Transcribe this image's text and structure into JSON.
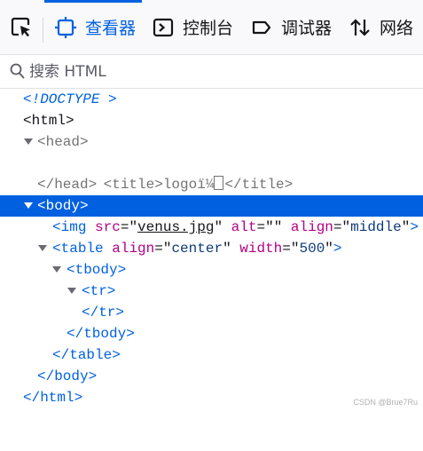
{
  "toolbar": {
    "tabs": [
      {
        "label": "查看器",
        "icon": "inspector-icon",
        "active": true
      },
      {
        "label": "控制台",
        "icon": "console-icon",
        "active": false
      },
      {
        "label": "调试器",
        "icon": "debugger-icon",
        "active": false
      },
      {
        "label": "网络",
        "icon": "network-icon",
        "active": false
      }
    ]
  },
  "search": {
    "placeholder": "搜索 HTML",
    "value": ""
  },
  "tree": {
    "doctype": "<!DOCTYPE >",
    "html_open": "<html>",
    "head_open": "<head>",
    "title_open": "<title>",
    "title_text": "logoï¼",
    "title_close": "</title>",
    "head_close": "</head>",
    "body_open": "<body>",
    "img_tag": "img",
    "img_src_attr": "src",
    "img_src_val": "venus.jpg",
    "img_alt_attr": "alt",
    "img_alt_val": "",
    "img_align_attr": "align",
    "img_align_val": "middle",
    "table_tag": "table",
    "table_align_attr": "align",
    "table_align_val": "center",
    "table_width_attr": "width",
    "table_width_val": "500",
    "tbody_open": "<tbody>",
    "tr_open": "<tr>",
    "tr_close": "</tr>",
    "tbody_close": "</tbody>",
    "table_close": "</table>",
    "body_close": "</body>",
    "html_close": "</html>"
  },
  "watermark": "CSDN @Brue7Ru",
  "colors": {
    "accent": "#0061e0",
    "selection": "#0060df",
    "attribute": "#b40084",
    "value": "#0e3a78"
  }
}
